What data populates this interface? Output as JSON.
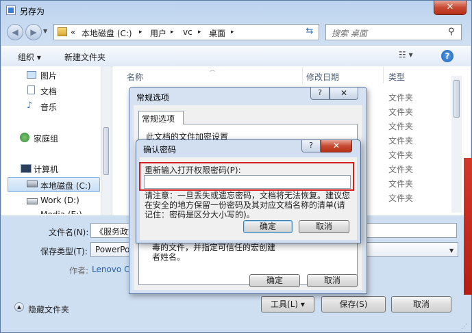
{
  "window": {
    "title": "另存为",
    "close_label": "✕"
  },
  "address": {
    "crumbs": [
      "«",
      "本地磁盘 (C:)",
      "▸",
      "用户",
      "▸",
      "vc",
      "▸",
      "桌面",
      "▸"
    ],
    "search_placeholder": "搜索 桌面"
  },
  "toolbar": {
    "organize_label": "组织 ▾",
    "newfolder_label": "新建文件夹",
    "view_label": "☷ ▾",
    "help_label": "?"
  },
  "nav": {
    "items": [
      {
        "label": "图片"
      },
      {
        "label": "文档"
      },
      {
        "label": "音乐"
      },
      {
        "label": "家庭组"
      },
      {
        "label": "计算机"
      },
      {
        "label": "本地磁盘 (C:)"
      },
      {
        "label": "Work (D:)"
      },
      {
        "label": "Media (E:)"
      }
    ]
  },
  "filelist": {
    "columns": {
      "name": "名称",
      "date": "修改日期",
      "type": "类型"
    },
    "types": [
      "文件夹",
      "文件夹",
      "文件夹",
      "文件夹",
      "文件夹",
      "文件夹",
      "文件夹",
      "文件夹",
      "文件夹"
    ]
  },
  "form": {
    "filename_label": "文件名(N):",
    "filename_value": "《服务政策",
    "savetype_label": "保存类型(T):",
    "savetype_value": "PowerPo",
    "author_label": "作者:",
    "author_value": "Lenovo Co"
  },
  "footer": {
    "hide_folders_label": "隐藏文件夹",
    "tools_label": "工具(L)  ▾",
    "save_label": "保存(S)",
    "cancel_label": "取消"
  },
  "general_dialog": {
    "title": "常规选项",
    "help_label": "?",
    "close_label": "✕",
    "tab_label": "常规选项",
    "section_label": "此文档的文件加密设置",
    "desc": "毒的文件，并指定可信任的宏创建者姓名。",
    "ok_label": "确定",
    "cancel_label": "取消"
  },
  "confirm_dialog": {
    "title": "确认密码",
    "help_label": "?",
    "close_label": "✕",
    "field_label": "重新输入打开权限密码(P):",
    "warning": "请注意：一旦丢失或遗忘密码，文档将无法恢复。建议您在安全的地方保留一份密码及其对应文档名称的清单(请记住：密码是区分大小写的)。",
    "ok_label": "确定",
    "cancel_label": "取消"
  }
}
